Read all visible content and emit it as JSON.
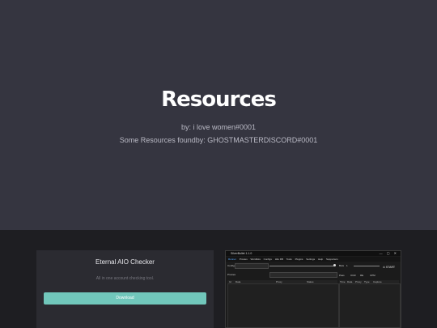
{
  "hero": {
    "title": "Resources",
    "credit": "by: i love women#0001",
    "found_by": "Some Resources foundby: GHOSTMASTERDISCORD#0001"
  },
  "card": {
    "title": "Eternal AIO Checker",
    "description": "All in one account checking tool.",
    "button_label": "Download"
  },
  "app_screenshot": {
    "window_title": "SilverBullet 1.1.0",
    "window_controls": "— ▢ ✕",
    "nav": [
      "Runner",
      "Proxies",
      "Wordlists",
      "Configs",
      "Hits DB",
      "Tools",
      "Plugins",
      "Settings",
      "Help",
      "Supporters"
    ],
    "active_nav": "Runner",
    "bots_label": "Bots",
    "bots_value": "1",
    "config_label": "Config",
    "proxy_label": "Proxies",
    "stats_labels": [
      "Pass",
      "OCR",
      "RE",
      "CPM"
    ],
    "start_label": "START",
    "table_columns": [
      "Id",
      "Data",
      "Proxy",
      "Status"
    ],
    "hits_columns": [
      "Time",
      "Data",
      "Proxy",
      "Type",
      "Capture"
    ]
  },
  "colors": {
    "hero_bg": "#353540",
    "page_bg": "#1e1e22",
    "card_bg": "#2b2b31",
    "accent": "#71c7bb"
  }
}
